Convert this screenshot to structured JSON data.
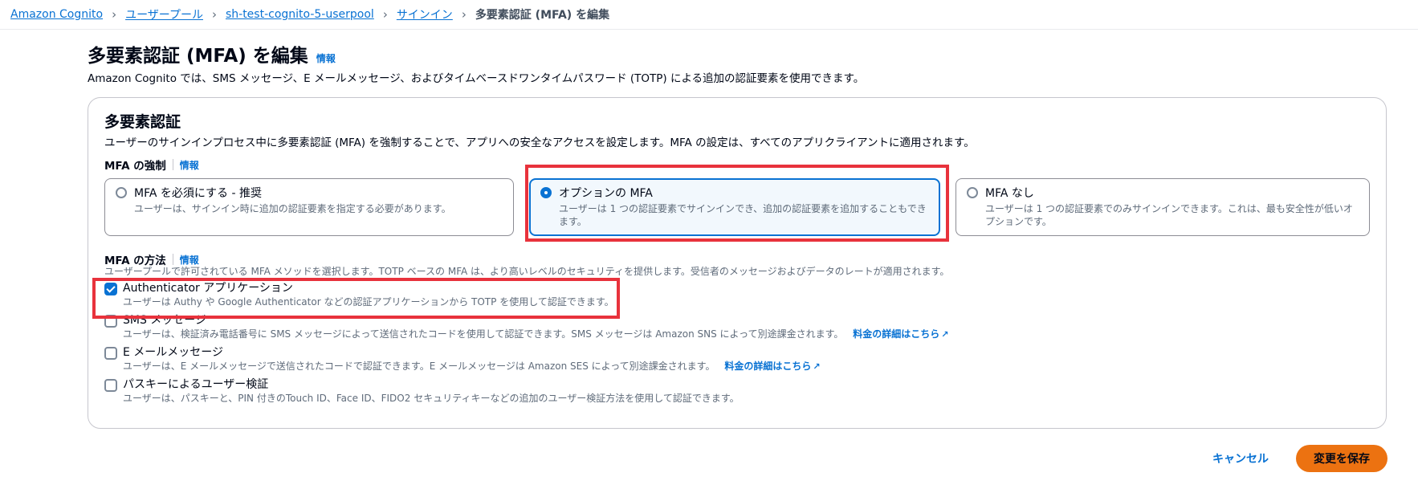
{
  "breadcrumb": {
    "items": [
      "Amazon Cognito",
      "ユーザープール",
      "sh-test-cognito-5-userpool",
      "サインイン"
    ],
    "current": "多要素認証 (MFA) を編集"
  },
  "page": {
    "title": "多要素認証 (MFA) を編集",
    "info": "情報",
    "description": "Amazon Cognito では、SMS メッセージ、E メールメッセージ、およびタイムベースドワンタイムパスワード (TOTP) による追加の認証要素を使用できます。"
  },
  "section": {
    "title": "多要素認証",
    "description": "ユーザーのサインインプロセス中に多要素認証 (MFA) を強制することで、アプリへの安全なアクセスを設定します。MFA の設定は、すべてのアプリクライアントに適用されます。"
  },
  "enforcement": {
    "label": "MFA の強制",
    "info": "情報",
    "options": [
      {
        "title": "MFA を必須にする - 推奨",
        "description": "ユーザーは、サインイン時に追加の認証要素を指定する必要があります。"
      },
      {
        "title": "オプションの MFA",
        "description": "ユーザーは 1 つの認証要素でサインインでき、追加の認証要素を追加することもできます。"
      },
      {
        "title": "MFA なし",
        "description": "ユーザーは 1 つの認証要素でのみサインインできます。これは、最も安全性が低いオプションです。"
      }
    ],
    "selected_index": 1
  },
  "methods": {
    "label": "MFA の方法",
    "info": "情報",
    "description": "ユーザープールで許可されている MFA メソッドを選択します。TOTP ベースの MFA は、より高いレベルのセキュリティを提供します。受信者のメッセージおよびデータのレートが適用されます。",
    "options": [
      {
        "label": "Authenticator アプリケーション",
        "description": "ユーザーは Authy や Google Authenticator などの認証アプリケーションから TOTP を使用して認証できます。",
        "checked": true,
        "link": ""
      },
      {
        "label": "SMS メッセージ",
        "description": "ユーザーは、検証済み電話番号に SMS メッセージによって送信されたコードを使用して認証できます。SMS メッセージは Amazon SNS によって別途課金されます。",
        "checked": false,
        "link": "料金の詳細はこちら"
      },
      {
        "label": "E メールメッセージ",
        "description": "ユーザーは、E メールメッセージで送信されたコードで認証できます。E メールメッセージは Amazon SES によって別途課金されます。",
        "checked": false,
        "link": "料金の詳細はこちら"
      },
      {
        "label": "パスキーによるユーザー検証",
        "description": "ユーザーは、パスキーと、PIN 付きのTouch ID、Face ID、FIDO2 セキュリティキーなどの追加のユーザー検証方法を使用して認証できます。",
        "checked": false,
        "link": ""
      }
    ]
  },
  "footer": {
    "cancel": "キャンセル",
    "save": "変更を保存"
  },
  "colors": {
    "link": "#0972d3",
    "primary_button": "#ec7211",
    "highlight": "#e8323c"
  },
  "icons": {
    "external_link": "external-link-icon",
    "breadcrumb_separator": "chevron-right-icon"
  }
}
